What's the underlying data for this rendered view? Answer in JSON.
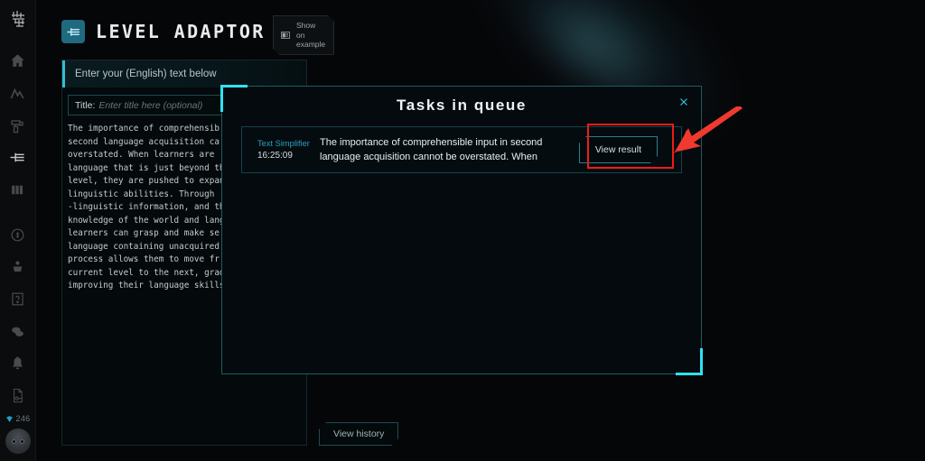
{
  "sidebar": {
    "logo_icon": "brand-glyph-icon",
    "items": [
      {
        "name": "home",
        "icon": "home-icon"
      },
      {
        "name": "analytics",
        "icon": "trend-line-icon"
      },
      {
        "name": "paint",
        "icon": "paint-roller-icon"
      },
      {
        "name": "level-adaptor",
        "icon": "level-adaptor-icon",
        "active": true
      },
      {
        "name": "library",
        "icon": "books-icon"
      },
      {
        "name": "rewards",
        "icon": "coin-refresh-icon"
      },
      {
        "name": "ink",
        "icon": "ink-pot-icon"
      },
      {
        "name": "help",
        "icon": "question-box-icon"
      },
      {
        "name": "chat",
        "icon": "chat-bubbles-icon"
      },
      {
        "name": "notifications",
        "icon": "bell-icon"
      },
      {
        "name": "documents",
        "icon": "document-icon"
      }
    ],
    "gem": {
      "icon": "gem-icon",
      "count": "246"
    },
    "avatar_icon": "user-avatar"
  },
  "header": {
    "brand_icon": "level-adaptor-logo-icon",
    "brand": "LEVEL ADAPTOR",
    "show_example": {
      "icon": "example-board-icon",
      "line1": "Show on",
      "line2": "example"
    }
  },
  "panel": {
    "heading": "Enter your (English) text below",
    "title_label": "Title:",
    "title_placeholder": "Enter title here (optional)",
    "body_text": "The importance of comprehensib\nsecond language acquisition ca\noverstated. When learners are \nlanguage that is just beyond th\nlevel, they are pushed to expan\nlinguistic abilities. Through \n-linguistic information, and th\nknowledge of the world and lang\nlearners can grasp and make se\nlanguage containing unacquired \nprocess allows them to move fr\ncurrent level to the next, grad\nimproving their language skills"
  },
  "view_history_label": "View history",
  "modal": {
    "title": "Tasks in queue",
    "close_icon": "close-icon",
    "task": {
      "name": "Text Simplifier",
      "time": "16:25:09",
      "snippet": "The importance of comprehensible input in second language acquisition cannot be overstated. When",
      "action_label": "View result"
    }
  },
  "annotation": {
    "highlight_color": "#ee1c19",
    "arrow_icon": "red-arrow-icon"
  },
  "colors": {
    "accent_cyan": "#2fe3f5",
    "accent_teal": "#2f9fc0",
    "background": "#050608"
  }
}
